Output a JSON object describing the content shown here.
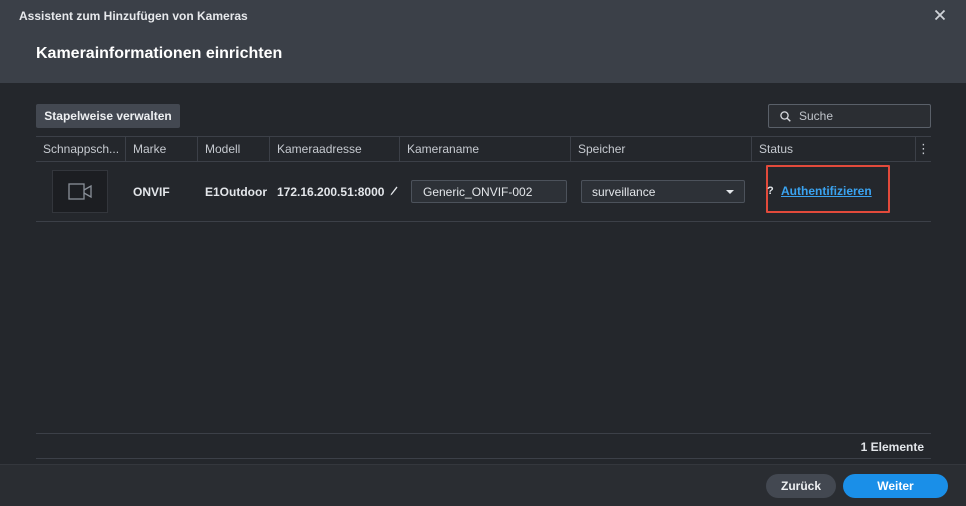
{
  "window": {
    "title": "Assistent zum Hinzufügen von Kameras",
    "close_icon": "close-icon"
  },
  "page": {
    "title": "Kamerainformationen einrichten"
  },
  "toolbar": {
    "batch_label": "Stapelweise verwalten",
    "search_placeholder": "Suche",
    "search_value": ""
  },
  "table": {
    "columns": [
      "Schnappsch...",
      "Marke",
      "Modell",
      "Kameraadresse",
      "Kameraname",
      "Speicher",
      "Status"
    ],
    "column_menu_icon": "more-vertical-icon",
    "rows": [
      {
        "snapshot_icon": "camera-icon",
        "brand": "ONVIF",
        "model": "E1Outdoor",
        "address": "172.16.200.51:8000",
        "name": "Generic_ONVIF-002",
        "storage": "surveillance",
        "status_icon": "?",
        "status_link": "Authentifizieren"
      }
    ]
  },
  "footer": {
    "count": "1 Elemente",
    "back_label": "Zurück",
    "next_label": "Weiter"
  },
  "colors": {
    "accent": "#1a8fe8",
    "link": "#3aa3f0",
    "highlight": "#e24a3b"
  }
}
